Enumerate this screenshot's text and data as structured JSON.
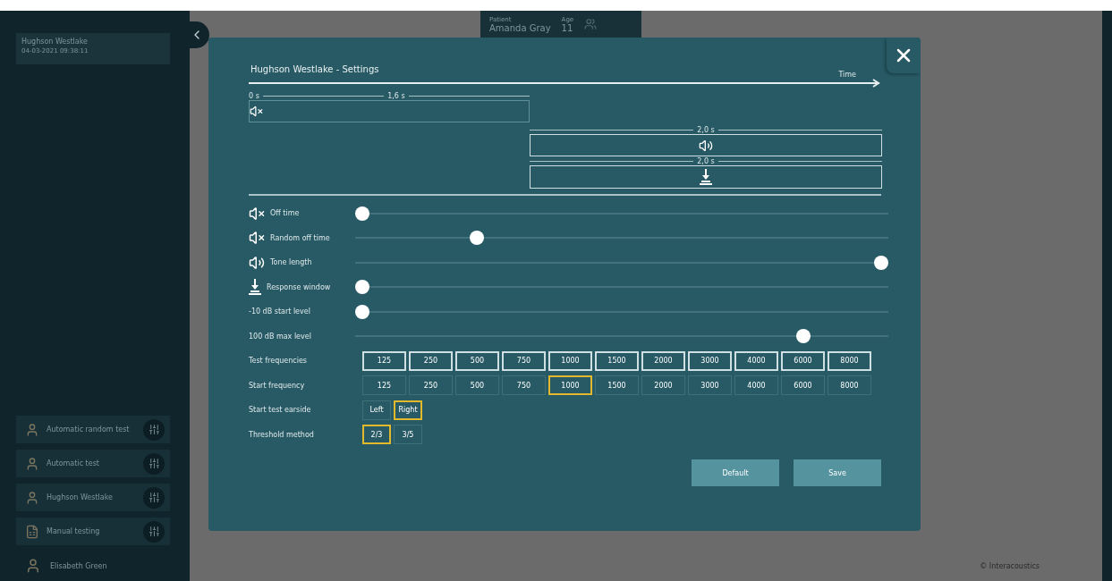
{
  "sidebar": {
    "session": {
      "title": "Hughson Westlake",
      "timestamp": "04-03-2021 09:38:11"
    },
    "tests": [
      {
        "label": "Automatic random test",
        "kind": "person"
      },
      {
        "label": "Automatic test",
        "kind": "person"
      },
      {
        "label": "Hughson Westlake",
        "kind": "person"
      },
      {
        "label": "Manual testing",
        "kind": "sheet"
      }
    ],
    "user": {
      "name": "Elisabeth Green"
    }
  },
  "patient": {
    "patient_label": "Patient",
    "name": "Amanda Gray",
    "age_label": "Age",
    "age": "11"
  },
  "footer": {
    "copyright": "© Interacoustics"
  },
  "modal": {
    "title": "Hughson Westlake - Settings",
    "axis_label": "Time",
    "diagram": {
      "start_label": "0 s",
      "off_duration": "1,6 s",
      "tone_duration": "2,0 s",
      "response_duration": "2,0 s"
    },
    "sliders": [
      {
        "label": "Off time",
        "kind": "mute",
        "level": 0
      },
      {
        "label": "Random off time",
        "kind": "mute",
        "level": 0.22
      },
      {
        "label": "Tone length",
        "kind": "tone",
        "level": 1
      },
      {
        "label": "Response window",
        "kind": "response",
        "level": 0
      },
      {
        "label": "-10 dB start level",
        "kind": "plain",
        "level": 0
      },
      {
        "label": "100 dB max level",
        "kind": "plain",
        "level": 0.85
      }
    ],
    "option_rows": [
      {
        "label": "Test frequencies",
        "options": [
          {
            "label": "125",
            "selected": true
          },
          {
            "label": "250",
            "selected": true
          },
          {
            "label": "500",
            "selected": true
          },
          {
            "label": "750",
            "selected": true
          },
          {
            "label": "1000",
            "selected": true
          },
          {
            "label": "1500",
            "selected": true
          },
          {
            "label": "2000",
            "selected": true
          },
          {
            "label": "3000",
            "selected": true
          },
          {
            "label": "4000",
            "selected": true
          },
          {
            "label": "6000",
            "selected": true
          },
          {
            "label": "8000",
            "selected": true
          }
        ]
      },
      {
        "label": "Start frequency",
        "options": [
          {
            "label": "125",
            "selected": false
          },
          {
            "label": "250",
            "selected": false
          },
          {
            "label": "500",
            "selected": false
          },
          {
            "label": "750",
            "selected": false
          },
          {
            "label": "1000",
            "selected": true
          },
          {
            "label": "1500",
            "selected": false
          },
          {
            "label": "2000",
            "selected": false
          },
          {
            "label": "3000",
            "selected": false
          },
          {
            "label": "4000",
            "selected": false
          },
          {
            "label": "6000",
            "selected": false
          },
          {
            "label": "8000",
            "selected": false
          }
        ]
      },
      {
        "label": "Start test earside",
        "options": [
          {
            "label": "Left",
            "selected": false
          },
          {
            "label": "Right",
            "selected": true
          }
        ]
      },
      {
        "label": "Threshold method",
        "options": [
          {
            "label": "2/3",
            "selected": true
          },
          {
            "label": "3/5",
            "selected": false
          }
        ]
      }
    ],
    "buttons": [
      "Default",
      "Save"
    ]
  }
}
